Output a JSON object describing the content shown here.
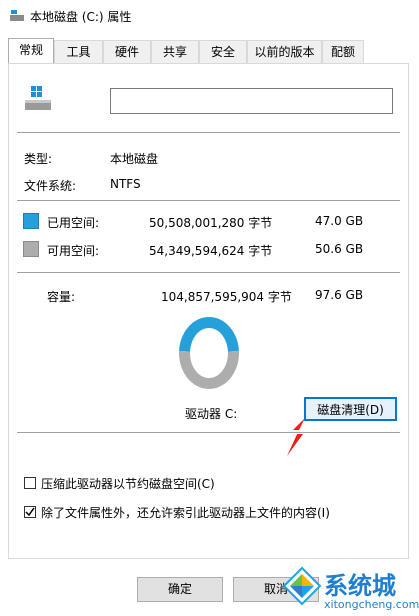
{
  "window": {
    "title": "本地磁盘 (C:) 属性"
  },
  "tabs": [
    {
      "label": "常规"
    },
    {
      "label": "工具"
    },
    {
      "label": "硬件"
    },
    {
      "label": "共享"
    },
    {
      "label": "安全"
    },
    {
      "label": "以前的版本"
    },
    {
      "label": "配额"
    }
  ],
  "general": {
    "name_value": "",
    "type_label": "类型:",
    "type_value": "本地磁盘",
    "fs_label": "文件系统:",
    "fs_value": "NTFS",
    "used_label": "已用空间:",
    "used_bytes": "50,508,001,280 字节",
    "used_size": "47.0 GB",
    "free_label": "可用空间:",
    "free_bytes": "54,349,594,624 字节",
    "free_size": "50.6 GB",
    "capacity_label": "容量:",
    "capacity_bytes": "104,857,595,904 字节",
    "capacity_size": "97.6 GB",
    "drive_label": "驱动器 C:",
    "cleanup_button": "磁盘清理(D)",
    "compress_label": "压缩此驱动器以节约磁盘空间(C)",
    "compress_checked": false,
    "index_label": "除了文件属性外，还允许索引此驱动器上文件的内容(I)",
    "index_checked": true,
    "used_fraction": 0.4817
  },
  "colors": {
    "used": "#26a0da",
    "free": "#adadad",
    "annotation_arrow": "#e8221b"
  },
  "footer": {
    "ok_button": "确定",
    "cancel_button": "取消"
  },
  "watermark": {
    "brand": "系统城",
    "url": "xitongcheng.com"
  }
}
